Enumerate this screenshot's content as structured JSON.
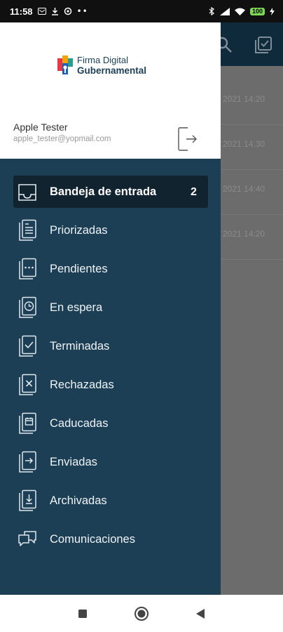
{
  "status_bar": {
    "time": "11:58",
    "battery": "100"
  },
  "background": {
    "row_timestamps": [
      "2021 14:20",
      "2021 14:30",
      "2021 14:40",
      "2021 14:20"
    ]
  },
  "drawer": {
    "logo": {
      "line1": "Firma Digital",
      "line2": "Gubernamental"
    },
    "user": {
      "name": "Apple Tester",
      "email": "apple_tester@yopmail.com"
    },
    "menu": [
      {
        "label": "Bandeja de entrada",
        "icon": "inbox-icon",
        "badge": "2",
        "active": true
      },
      {
        "label": "Priorizadas",
        "icon": "priority-icon"
      },
      {
        "label": "Pendientes",
        "icon": "pending-icon"
      },
      {
        "label": "En espera",
        "icon": "clock-icon"
      },
      {
        "label": "Terminadas",
        "icon": "check-icon"
      },
      {
        "label": "Rechazadas",
        "icon": "reject-icon"
      },
      {
        "label": "Caducadas",
        "icon": "calendar-icon"
      },
      {
        "label": "Enviadas",
        "icon": "send-icon"
      },
      {
        "label": "Archivadas",
        "icon": "archive-icon"
      },
      {
        "label": "Comunicaciones",
        "icon": "chat-icon"
      }
    ]
  },
  "colors": {
    "drawer_bg": "#1c3f56",
    "active_bg": "#10232f",
    "header_bg": "#ffffff"
  }
}
